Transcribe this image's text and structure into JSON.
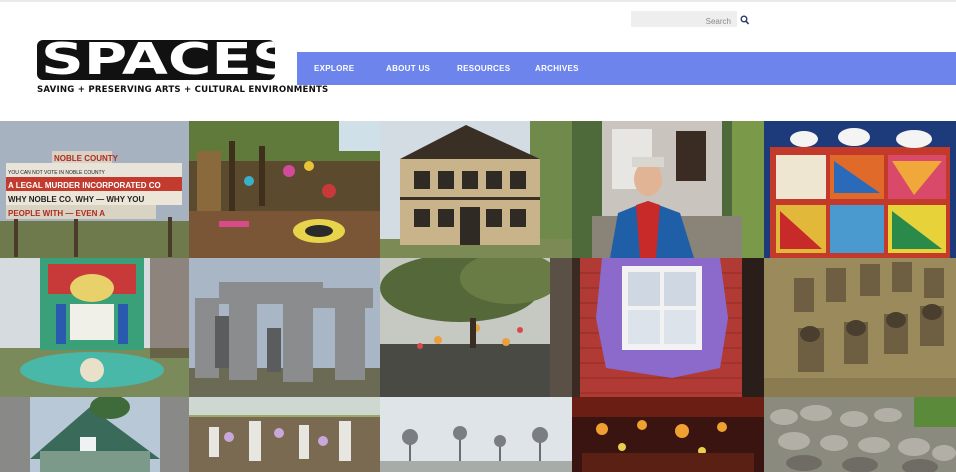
{
  "search": {
    "placeholder": "Search",
    "value": ""
  },
  "logo": {
    "wordmark": "SPACES",
    "tagline": "SAVING + PRESERVING ARTS + CULTURAL ENVIRONMENTS"
  },
  "nav": {
    "items": [
      {
        "label": "EXPLORE"
      },
      {
        "label": "ABOUT US"
      },
      {
        "label": "RESOURCES"
      },
      {
        "label": "ARCHIVES"
      }
    ]
  },
  "gallery": {
    "sign": {
      "lines": [
        "NOBLE COUNTY",
        "YOU CAN NOT VOTE IN NOBLE COUNTY",
        "A LEGAL MURDER INCORPORATED CO",
        "WHY NOBLE CO. WHY — WHY YOU",
        "PEOPLE WITH — EVEN A"
      ]
    }
  },
  "colors": {
    "nav_bg": "#6c84ec",
    "nav_text": "#ffffff",
    "logo": "#111111"
  }
}
